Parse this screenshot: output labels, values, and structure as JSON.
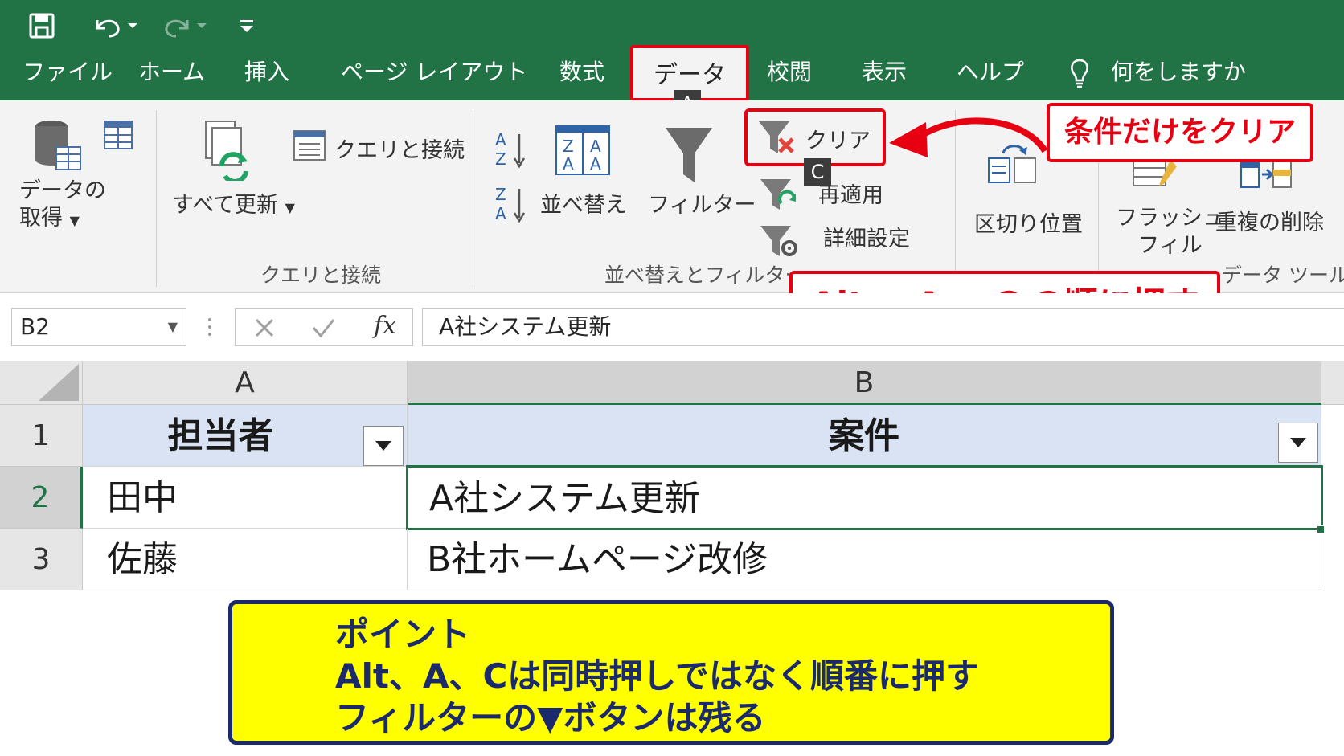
{
  "tabs": [
    "ファイル",
    "ホーム",
    "挿入",
    "ページ レイアウト",
    "数式",
    "データ",
    "校閲",
    "表示",
    "ヘルプ"
  ],
  "tell_me": "何をしますか",
  "keytips": {
    "data_tab": "A",
    "clear": "C"
  },
  "ribbon": {
    "get_data": [
      "データの",
      "取得"
    ],
    "refresh_all": "すべて更新",
    "queries_connections": "クエリと接続",
    "group_queries": "クエリと接続",
    "sort": "並べ替え",
    "filter": "フィルター",
    "clear": "クリア",
    "reapply": "再適用",
    "advanced": "詳細設定",
    "group_sort_filter": "並べ替えとフィルター",
    "text_to_columns": "区切り位置",
    "flash_fill": [
      "フラッシュ",
      "フィル"
    ],
    "remove_duplicates": "重複の削除",
    "group_data_tools": "データ ツール"
  },
  "callouts": {
    "clear_only": "条件だけをクリア",
    "sequence": "Alt → A → C の順に押す"
  },
  "formula_bar": {
    "name_box": "B2",
    "fx": "fx",
    "formula": "A社システム更新"
  },
  "sheet": {
    "columns": [
      "A",
      "B"
    ],
    "rows": [
      "1",
      "2",
      "3"
    ],
    "cells": [
      [
        "担当者",
        "案件"
      ],
      [
        "田中",
        "A社システム更新"
      ],
      [
        "佐藤",
        "B社ホームページ改修"
      ]
    ]
  },
  "point": {
    "title": "ポイント",
    "line1": "Alt、A、Cは同時押しではなく順番に押す",
    "line2": "フィルターの▼ボタンは残る"
  },
  "colors": {
    "excel_green": "#217346",
    "alert_red": "#e60012",
    "header_fill": "#dae3f3",
    "point_bg": "#ffff00",
    "point_text": "#1a2a6c"
  }
}
